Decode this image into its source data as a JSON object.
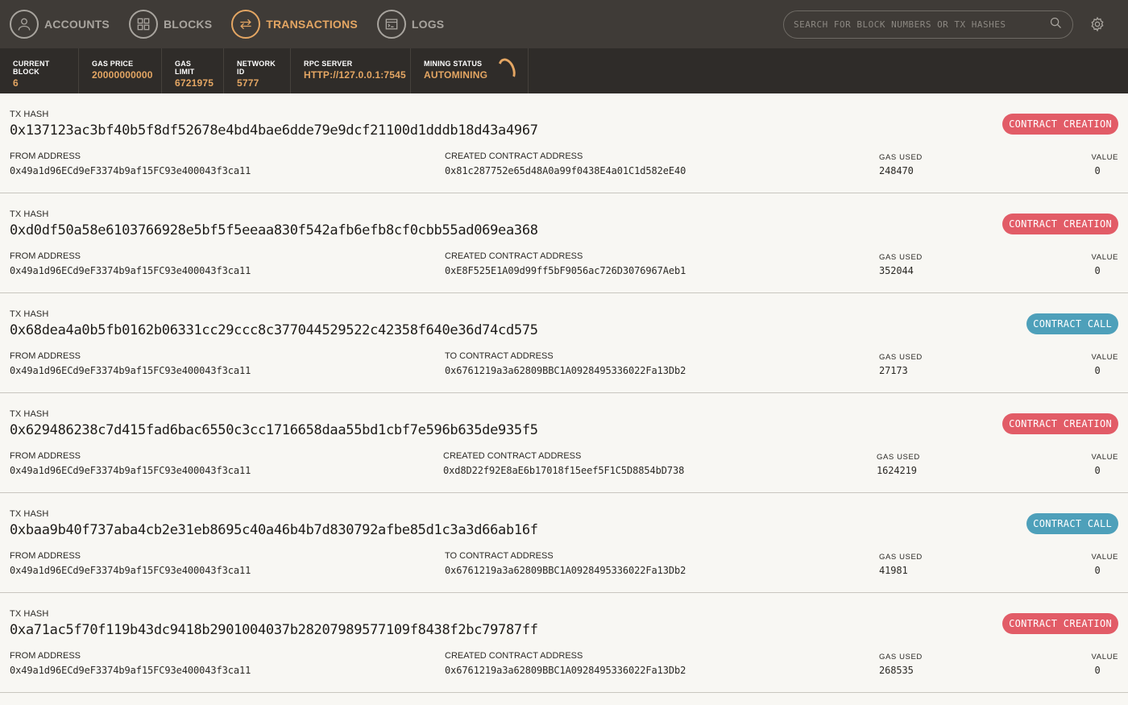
{
  "nav": {
    "items": [
      {
        "label": "ACCOUNTS",
        "icon": "user-icon",
        "active": false
      },
      {
        "label": "BLOCKS",
        "icon": "grid-icon",
        "active": false
      },
      {
        "label": "TRANSACTIONS",
        "icon": "swap-icon",
        "active": true
      },
      {
        "label": "LOGS",
        "icon": "terminal-icon",
        "active": false
      }
    ],
    "search_placeholder": "SEARCH FOR BLOCK NUMBERS OR TX HASHES"
  },
  "status": {
    "current_block": {
      "label": "CURRENT BLOCK",
      "value": "6"
    },
    "gas_price": {
      "label": "GAS PRICE",
      "value": "20000000000"
    },
    "gas_limit": {
      "label": "GAS LIMIT",
      "value": "6721975"
    },
    "network_id": {
      "label": "NETWORK ID",
      "value": "5777"
    },
    "rpc_server": {
      "label": "RPC SERVER",
      "value": "HTTP://127.0.0.1:7545"
    },
    "mining_status": {
      "label": "MINING STATUS",
      "value": "AUTOMINING"
    }
  },
  "labels": {
    "tx_hash": "TX HASH",
    "from_address": "FROM ADDRESS",
    "gas_used": "GAS USED",
    "value": "VALUE"
  },
  "transactions": [
    {
      "hash": "0x137123ac3bf40b5f8df52678e4bd4bae6dde79e9dcf21100d1dddb18d43a4967",
      "type": "CONTRACT CREATION",
      "from": "0x49a1d96ECd9eF3374b9af15FC93e400043f3ca11",
      "contract_label": "CREATED CONTRACT ADDRESS",
      "contract": "0x81c287752e65d48A0a99f0438E4a01C1d582eE40",
      "gas_used": "248470",
      "value": "0"
    },
    {
      "hash": "0xd0df50a58e6103766928e5bf5f5eeaa830f542afb6efb8cf0cbb55ad069ea368",
      "type": "CONTRACT CREATION",
      "from": "0x49a1d96ECd9eF3374b9af15FC93e400043f3ca11",
      "contract_label": "CREATED CONTRACT ADDRESS",
      "contract": "0xE8F525E1A09d99ff5bF9056ac726D3076967Aeb1",
      "gas_used": "352044",
      "value": "0"
    },
    {
      "hash": "0x68dea4a0b5fb0162b06331cc29ccc8c377044529522c42358f640e36d74cd575",
      "type": "CONTRACT CALL",
      "from": "0x49a1d96ECd9eF3374b9af15FC93e400043f3ca11",
      "contract_label": "TO CONTRACT ADDRESS",
      "contract": "0x6761219a3a62809BBC1A0928495336022Fa13Db2",
      "gas_used": "27173",
      "value": "0"
    },
    {
      "hash": "0x629486238c7d415fad6bac6550c3cc1716658daa55bd1cbf7e596b635de935f5",
      "type": "CONTRACT CREATION",
      "from": "0x49a1d96ECd9eF3374b9af15FC93e400043f3ca11",
      "contract_label": "CREATED CONTRACT ADDRESS",
      "contract": "0xd8D22f92E8aE6b17018f15eef5F1C5D8854bD738",
      "gas_used": "1624219",
      "value": "0"
    },
    {
      "hash": "0xbaa9b40f737aba4cb2e31eb8695c40a46b4b7d830792afbe85d1c3a3d66ab16f",
      "type": "CONTRACT CALL",
      "from": "0x49a1d96ECd9eF3374b9af15FC93e400043f3ca11",
      "contract_label": "TO CONTRACT ADDRESS",
      "contract": "0x6761219a3a62809BBC1A0928495336022Fa13Db2",
      "gas_used": "41981",
      "value": "0"
    },
    {
      "hash": "0xa71ac5f70f119b43dc9418b2901004037b28207989577109f8438f2bc79787ff",
      "type": "CONTRACT CREATION",
      "from": "0x49a1d96ECd9eF3374b9af15FC93e400043f3ca11",
      "contract_label": "CREATED CONTRACT ADDRESS",
      "contract": "0x6761219a3a62809BBC1A0928495336022Fa13Db2",
      "gas_used": "268535",
      "value": "0"
    }
  ],
  "colors": {
    "accent": "#e4a663",
    "creation": "#e25c67",
    "call": "#4ea0ba",
    "nav_bg": "#3f3b37",
    "status_bg": "#2f2c29"
  }
}
